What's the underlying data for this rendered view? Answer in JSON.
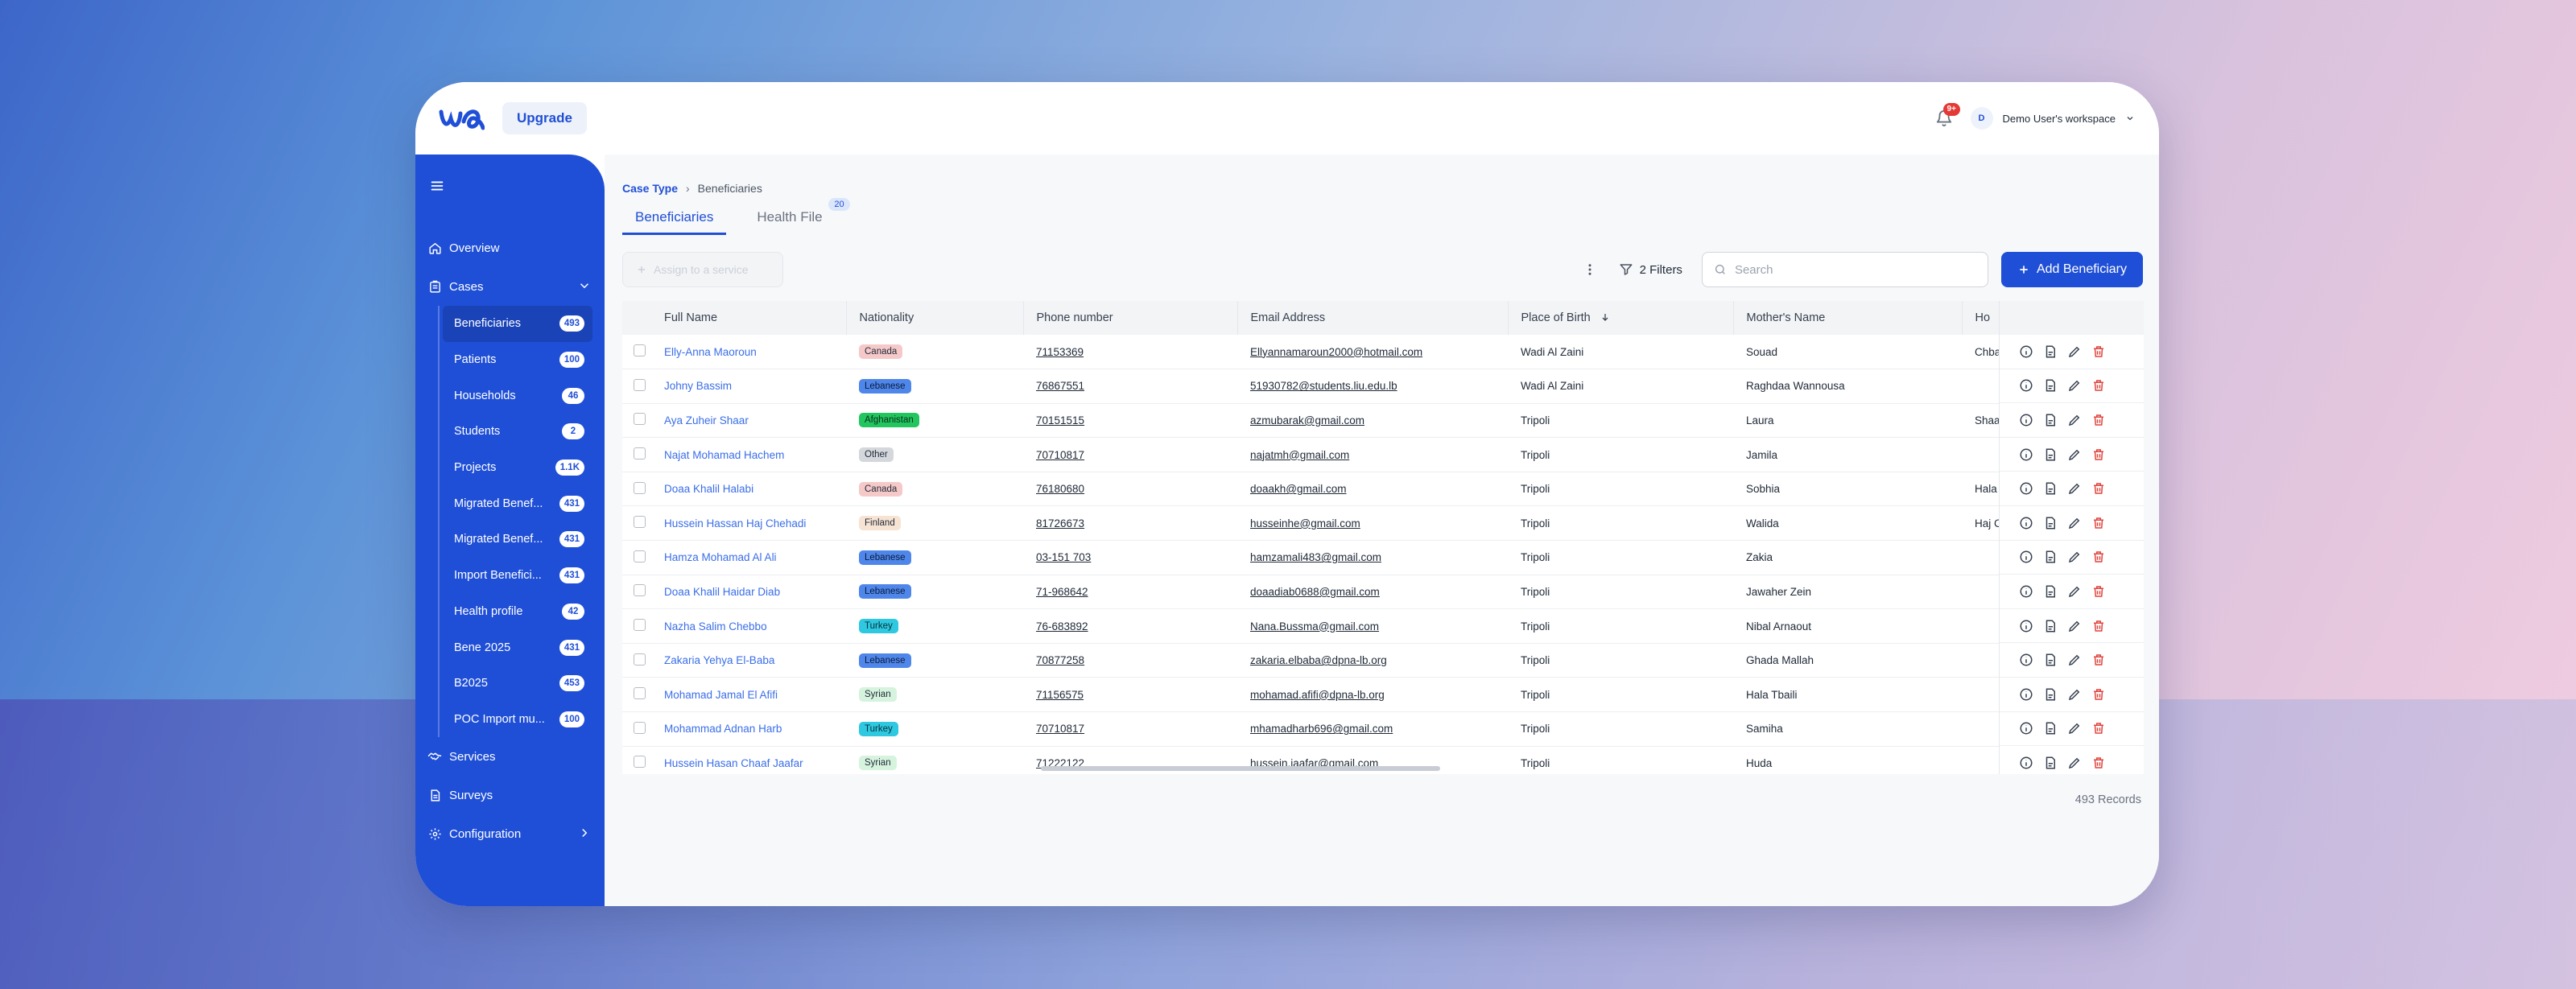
{
  "app": {
    "upgrade_label": "Upgrade",
    "notification_count": "9+",
    "workspace_initial": "D",
    "workspace_name": "Demo User's workspace"
  },
  "sidebar": {
    "top_items": [
      {
        "label": "Overview",
        "icon": "home-icon"
      },
      {
        "label": "Cases",
        "icon": "folder-icon"
      }
    ],
    "sub_items": [
      {
        "label": "Beneficiaries",
        "count": "493",
        "active": true
      },
      {
        "label": "Patients",
        "count": "100"
      },
      {
        "label": "Households",
        "count": "46"
      },
      {
        "label": "Students",
        "count": "2"
      },
      {
        "label": "Projects",
        "count": "1.1K"
      },
      {
        "label": "Migrated Benef...",
        "count": "431"
      },
      {
        "label": "Migrated Benef...",
        "count": "431"
      },
      {
        "label": "Import Benefici...",
        "count": "431"
      },
      {
        "label": "Health profile",
        "count": "42"
      },
      {
        "label": "Bene 2025",
        "count": "431"
      },
      {
        "label": "B2025",
        "count": "453"
      },
      {
        "label": "POC Import mu...",
        "count": "100"
      }
    ],
    "bottom_items": [
      {
        "label": "Services",
        "icon": "handshake-icon"
      },
      {
        "label": "Surveys",
        "icon": "document-icon"
      },
      {
        "label": "Configuration",
        "icon": "gear-icon"
      }
    ]
  },
  "breadcrumb": {
    "parent": "Case Type",
    "current": "Beneficiaries"
  },
  "tabs": [
    {
      "label": "Beneficiaries",
      "active": true
    },
    {
      "label": "Health File",
      "badge": "20"
    }
  ],
  "toolbar": {
    "assign_label": "Assign to a service",
    "filters_label": "2 Filters",
    "search_placeholder": "Search",
    "add_label": "Add Beneficiary"
  },
  "table": {
    "columns": [
      "Full Name",
      "Nationality",
      "Phone number",
      "Email Address",
      "Place of Birth",
      "Mother's Name",
      "Ho"
    ],
    "rows": [
      {
        "name": "Elly-Anna Maoroun",
        "nationality": "Canada",
        "phone": "71153369",
        "email": "Ellyannamaroun2000@hotmail.com",
        "pob": "Wadi Al Zaini",
        "mother": "Souad",
        "extra": "Chba"
      },
      {
        "name": "Johny Bassim",
        "nationality": "Lebanese",
        "phone": "76867551",
        "email": "51930782@students.liu.edu.lb",
        "pob": "Wadi Al Zaini",
        "mother": "Raghdaa Wannousa",
        "extra": ""
      },
      {
        "name": "Aya Zuheir Shaar",
        "nationality": "Afghanistan",
        "phone": "70151515",
        "email": "azmubarak@gmail.com",
        "pob": "Tripoli",
        "mother": "Laura",
        "extra": "Shaa"
      },
      {
        "name": "Najat Mohamad Hachem",
        "nationality": "Other",
        "phone": "70710817",
        "email": "najatmh@gmail.com",
        "pob": "Tripoli",
        "mother": "Jamila",
        "extra": ""
      },
      {
        "name": "Doaa Khalil Halabi",
        "nationality": "Canada",
        "phone": "76180680",
        "email": "doaakh@gmail.com",
        "pob": "Tripoli",
        "mother": "Sobhia",
        "extra": "Hala"
      },
      {
        "name": "Hussein Hassan Haj Chehadi",
        "nationality": "Finland",
        "phone": "81726673",
        "email": "husseinhe@gmail.com",
        "pob": "Tripoli",
        "mother": "Walida",
        "extra": "Haj C"
      },
      {
        "name": "Hamza Mohamad Al Ali",
        "nationality": "Lebanese",
        "phone": "03-151 703",
        "email": "hamzamali483@gmail.com",
        "pob": "Tripoli",
        "mother": "Zakia",
        "extra": ""
      },
      {
        "name": "Doaa Khalil Haidar Diab",
        "nationality": "Lebanese",
        "phone": "71-968642",
        "email": "doaadiab0688@gmail.com",
        "pob": "Tripoli",
        "mother": "Jawaher Zein",
        "extra": ""
      },
      {
        "name": "Nazha Salim Chebbo",
        "nationality": "Turkey",
        "phone": "76-683892",
        "email": "Nana.Bussma@gmail.com",
        "pob": "Tripoli",
        "mother": "Nibal Arnaout",
        "extra": ""
      },
      {
        "name": "Zakaria Yehya El-Baba",
        "nationality": "Lebanese",
        "phone": "70877258",
        "email": "zakaria.elbaba@dpna-lb.org",
        "pob": "Tripoli",
        "mother": "Ghada Mallah",
        "extra": ""
      },
      {
        "name": "Mohamad Jamal El Afifi",
        "nationality": "Syrian",
        "phone": "71156575",
        "email": "mohamad.afifi@dpna-lb.org",
        "pob": "Tripoli",
        "mother": "Hala Tbaili",
        "extra": ""
      },
      {
        "name": "Mohammad Adnan Harb",
        "nationality": "Turkey",
        "phone": "70710817",
        "email": "mhamadharb696@gmail.com",
        "pob": "Tripoli",
        "mother": "Samiha",
        "extra": ""
      },
      {
        "name": "Hussein Hasan Chaaf Jaafar",
        "nationality": "Syrian",
        "phone": "71222122",
        "email": "hussein.jaafar@gmail.com",
        "pob": "Tripoli",
        "mother": "Huda",
        "extra": ""
      }
    ],
    "records_label": "493 Records"
  },
  "colors": {
    "brand": "#1f4fd6",
    "badge_canada": "#f6c9c9",
    "badge_lebanese": "#4f86ea",
    "badge_afghanistan": "#22c55e",
    "badge_other": "#d4d7dc",
    "badge_finland": "#f6e3d3",
    "badge_turkey": "#2ec8e0",
    "badge_syrian": "#d6f3de",
    "delete_icon": "#e0443e"
  }
}
